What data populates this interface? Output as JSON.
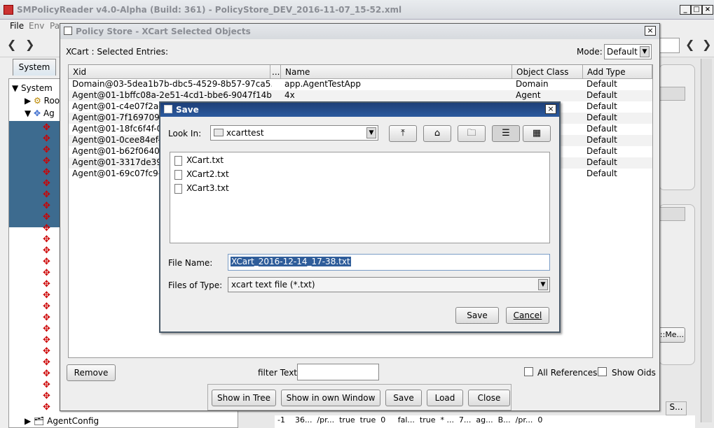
{
  "main_window": {
    "title": "SMPolicyReader v4.0-Alpha (Build: 361) - PolicyStore_DEV_2016-11-07_15-52.xml",
    "menu": [
      "File",
      "Env",
      "Pa"
    ],
    "tab_label": "System",
    "tree": {
      "root_label": "System",
      "items": [
        "Roo",
        "Ag"
      ],
      "bottom_item": "AgentConfig"
    },
    "right_fragments": {
      "me_button": "::Me...",
      "s_header": "S...",
      "bottom_row": "-1    36...  /pr...  true  true  0     fal...  true  * ...  7...  ag...  B...  /pr...  0"
    }
  },
  "policy_dialog": {
    "title": "Policy Store - XCart Selected Objects",
    "entries_label": "XCart : Selected Entries:",
    "mode_label": "Mode:",
    "mode_value": "Default",
    "columns": [
      "Xid",
      "...",
      "Name",
      "Object Class",
      "Add Type"
    ],
    "rows": [
      {
        "xid": "Domain@03-5dea1b7b-dbc5-4529-8b57-97ca5...",
        "name": "app.AgentTestApp",
        "cls": "Domain",
        "type": "Default"
      },
      {
        "xid": "Agent@01-1bffc08a-2e51-4cd1-bbe6-9047f14b6...",
        "name": "4x",
        "cls": "Agent",
        "type": "Default"
      },
      {
        "xid": "Agent@01-c4e07f2a-e",
        "name": "",
        "cls": "",
        "type": "Default"
      },
      {
        "xid": "Agent@01-7f169709-8",
        "name": "",
        "cls": "",
        "type": "Default"
      },
      {
        "xid": "Agent@01-18fc6f4f-07",
        "name": "",
        "cls": "",
        "type": "Default"
      },
      {
        "xid": "Agent@01-0cee84ef-9",
        "name": "",
        "cls": "",
        "type": "Default"
      },
      {
        "xid": "Agent@01-b62f0640-7",
        "name": "",
        "cls": "",
        "type": "Default"
      },
      {
        "xid": "Agent@01-3317de39-6",
        "name": "",
        "cls": "",
        "type": "Default"
      },
      {
        "xid": "Agent@01-69c07fc9-e",
        "name": "",
        "cls": "",
        "type": "Default"
      }
    ],
    "remove_label": "Remove",
    "filter_label": "filter Text:",
    "filter_value": "",
    "all_refs_label": "All References",
    "show_oids_label": "Show Oids",
    "buttons": {
      "show_tree": "Show in Tree",
      "show_window": "Show in own Window",
      "save": "Save",
      "load": "Load",
      "close": "Close"
    }
  },
  "save_dialog": {
    "title": "Save",
    "look_in_label": "Look In:",
    "look_in_value": "xcarttest",
    "files": [
      "XCart.txt",
      "XCart2.txt",
      "XCart3.txt"
    ],
    "file_name_label": "File Name:",
    "file_name_value": "XCart_2016-12-14_17-38.txt",
    "files_of_type_label": "Files of Type:",
    "files_of_type_value": "xcart text file (*.txt)",
    "save_label": "Save",
    "cancel_label": "Cancel"
  }
}
